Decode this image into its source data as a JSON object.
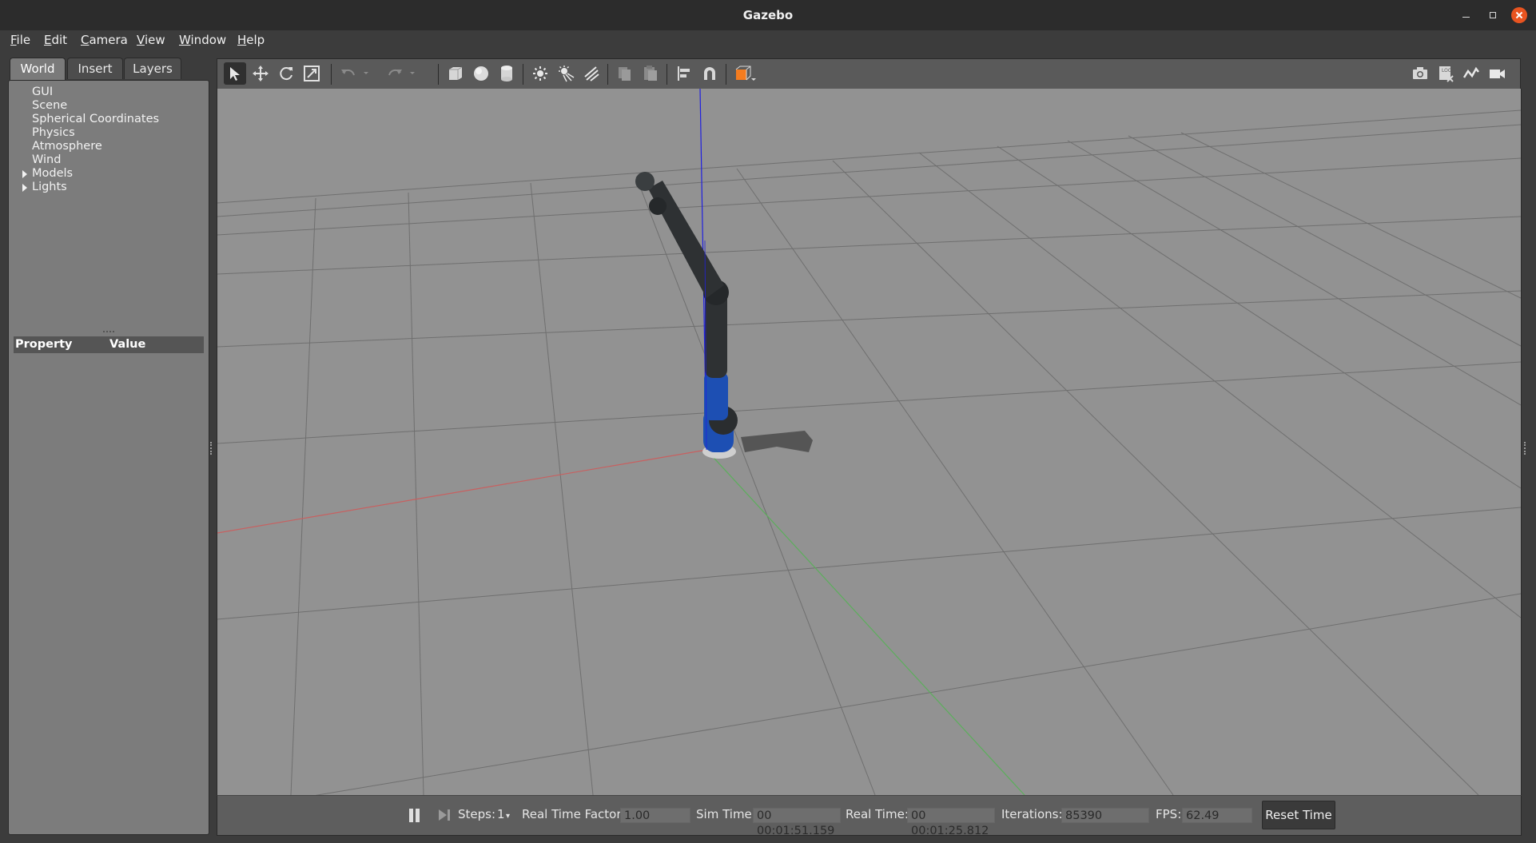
{
  "window": {
    "title": "Gazebo"
  },
  "menu": {
    "items": [
      "File",
      "Edit",
      "Camera",
      "View",
      "Window",
      "Help"
    ]
  },
  "left_panel": {
    "tabs": [
      "World",
      "Insert",
      "Layers"
    ],
    "active_tab": "World",
    "tree": [
      {
        "label": "GUI",
        "expandable": false
      },
      {
        "label": "Scene",
        "expandable": false
      },
      {
        "label": "Spherical Coordinates",
        "expandable": false
      },
      {
        "label": "Physics",
        "expandable": false
      },
      {
        "label": "Atmosphere",
        "expandable": false
      },
      {
        "label": "Wind",
        "expandable": false
      },
      {
        "label": "Models",
        "expandable": true
      },
      {
        "label": "Lights",
        "expandable": true
      }
    ],
    "property_header": {
      "property": "Property",
      "value": "Value"
    }
  },
  "toolbar": {
    "tools": [
      "select-mode",
      "translate-mode",
      "rotate-mode",
      "scale-mode",
      "undo",
      "undo-history",
      "redo",
      "redo-history",
      "box",
      "sphere",
      "cylinder",
      "point-light",
      "spot-light",
      "directional-light",
      "copy",
      "paste",
      "align",
      "snap",
      "view-angle"
    ],
    "right_tools": [
      "screenshot",
      "log",
      "plot",
      "video-record"
    ],
    "active_tool": "select-mode",
    "accent_color": "#f57c1f"
  },
  "bottom_bar": {
    "steps_label": "Steps:",
    "steps_value": "1",
    "rtf_label": "Real Time Factor:",
    "rtf_value": "1.00",
    "sim_time_label": "Sim Time:",
    "sim_time_value": "00 00:01:51.159",
    "real_time_label": "Real Time:",
    "real_time_value": "00 00:01:25.812",
    "iterations_label": "Iterations:",
    "iterations_value": "85390",
    "fps_label": "FPS:",
    "fps_value": "62.49",
    "reset_label": "Reset Time"
  },
  "colors": {
    "close_button": "#e95420",
    "viewport_bg": "#929292",
    "axis_x": "#c86060",
    "axis_y": "#5cae5c",
    "axis_z": "#2020e0",
    "robot_link": "#2e3133",
    "robot_joint": "#1d4fb3"
  }
}
